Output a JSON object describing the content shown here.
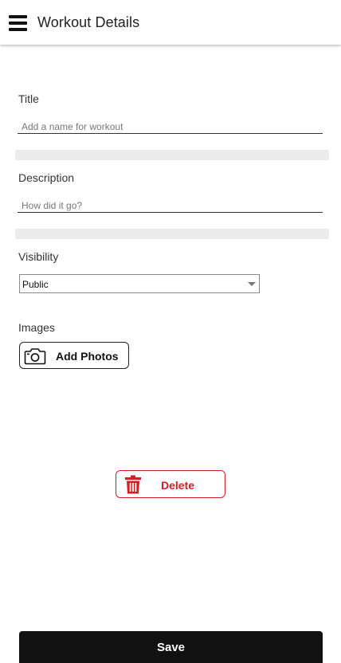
{
  "header": {
    "title": "Workout Details",
    "menu_icon": "hamburger-menu-icon"
  },
  "form": {
    "title": {
      "label": "Title",
      "value": "",
      "placeholder": "Add a name for workout"
    },
    "description": {
      "label": "Description",
      "value": "",
      "placeholder": "How did it go?"
    },
    "visibility": {
      "label": "Visibility",
      "selected": "Public"
    },
    "images": {
      "label": "Images",
      "add_button_label": "Add Photos",
      "add_button_icon": "camera-icon"
    }
  },
  "actions": {
    "delete_label": "Delete",
    "delete_icon": "trash-icon",
    "save_label": "Save"
  },
  "colors": {
    "danger": "#d11f28",
    "primary_dark": "#111111",
    "separator": "#ececec"
  }
}
